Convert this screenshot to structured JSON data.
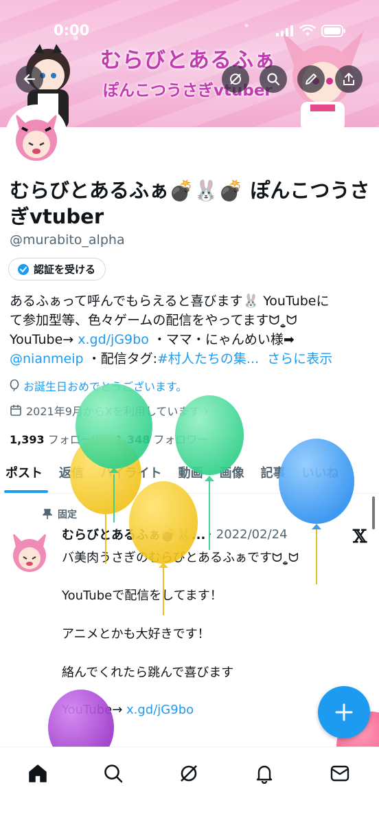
{
  "status": {
    "time": "0:00"
  },
  "banner": {
    "title": "むらびとあるふぁ",
    "subtitle": "ぽんこつうさぎvtuber"
  },
  "profile": {
    "name": "むらびとあるふぁ💣🐰💣 ぽんこつうさぎvtuber",
    "handle": "@murabito_alpha",
    "verify_label": "認証を受ける",
    "bio_line1": "あるふぁって呼んでもらえると喜びます🐰 YouTubeに",
    "bio_line2": "て参加型等、色々ゲームの配信をやってますᗢ˳̫ᗢ",
    "bio_line3_pre": "YouTube→ ",
    "bio_link1": "x.gd/jG9bo",
    "bio_line3_post": " ・ママ・にゃんめい様➡",
    "bio_mention": "@nianmeip",
    "bio_line4_mid": " ・配信タグ:",
    "bio_hashtag": "#村人たちの集...",
    "bio_more": "さらに表示",
    "birthday": "お誕生日おめでとうございます。",
    "joined": "2021年9月からXを利用しています",
    "following_count": "1,393",
    "following_label": "フォロー中",
    "followers_count": "1,348",
    "followers_label": "フォロワー"
  },
  "tabs": [
    "ポスト",
    "返信",
    "ハイライト",
    "動画",
    "画像",
    "記事",
    "いいね"
  ],
  "tweet": {
    "pinned_label": "固定",
    "name": "むらびとあるふぁ💣🐰...",
    "date": "· 2022/02/24",
    "line1": "バ美肉うさぎのむらびとあるふぁですᗢ˳̫ᗢ",
    "line2": "YouTubeで配信をしてます！",
    "line3": "アニメとかも大好きです！",
    "line4": "絡んでくれたら跳んで喜びます",
    "line5_pre": "YouTube→ ",
    "line5_link": "x.gd/jG9bo"
  },
  "colors": {
    "accent": "#1d9bf0",
    "banner_text": "#c03bb0"
  },
  "icons": [
    "back-icon",
    "grok-icon",
    "search-icon",
    "edit-icon",
    "share-icon",
    "verified-icon",
    "balloon-icon",
    "calendar-icon",
    "pin-icon",
    "plus-icon",
    "home-icon",
    "explore-icon",
    "notification-icon",
    "messages-icon"
  ]
}
